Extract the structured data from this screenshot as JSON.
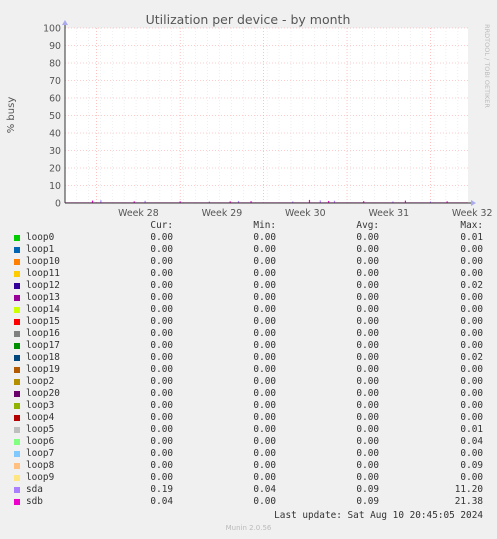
{
  "chart_data": {
    "type": "line",
    "title": "Utilization per device - by month",
    "ylabel": "% busy",
    "side_label": "RRDTOOL / TOBI OETIKER",
    "ylim": [
      0,
      100
    ],
    "yticks": [
      0,
      10,
      20,
      30,
      40,
      50,
      60,
      70,
      80,
      90,
      100
    ],
    "xticks": [
      "Week 28",
      "Week 29",
      "Week 30",
      "Week 31",
      "Week 32"
    ],
    "grid": true,
    "series": [
      {
        "name": "loop0",
        "color": "#00cc00"
      },
      {
        "name": "loop1",
        "color": "#0066b3"
      },
      {
        "name": "loop10",
        "color": "#ff8000"
      },
      {
        "name": "loop11",
        "color": "#ffcc00"
      },
      {
        "name": "loop12",
        "color": "#330099"
      },
      {
        "name": "loop13",
        "color": "#990099"
      },
      {
        "name": "loop14",
        "color": "#ccff00"
      },
      {
        "name": "loop15",
        "color": "#ff0000"
      },
      {
        "name": "loop16",
        "color": "#808080"
      },
      {
        "name": "loop17",
        "color": "#008f00"
      },
      {
        "name": "loop18",
        "color": "#00487d"
      },
      {
        "name": "loop19",
        "color": "#b35a00"
      },
      {
        "name": "loop2",
        "color": "#b38f00"
      },
      {
        "name": "loop20",
        "color": "#6b006b"
      },
      {
        "name": "loop3",
        "color": "#8fb300"
      },
      {
        "name": "loop4",
        "color": "#b30000"
      },
      {
        "name": "loop5",
        "color": "#bebebe"
      },
      {
        "name": "loop6",
        "color": "#80ff80"
      },
      {
        "name": "loop7",
        "color": "#80c9ff"
      },
      {
        "name": "loop8",
        "color": "#ffc080"
      },
      {
        "name": "loop9",
        "color": "#ffe680"
      },
      {
        "name": "sda",
        "color": "#aa80ff"
      },
      {
        "name": "sdb",
        "color": "#ee00cc"
      }
    ],
    "spikes": [
      {
        "week": 28.05,
        "value": 0.8
      },
      {
        "week": 28.15,
        "value": 1.0
      },
      {
        "week": 28.55,
        "value": 0.4
      },
      {
        "week": 28.68,
        "value": 0.7
      },
      {
        "week": 29.1,
        "value": 0.4
      },
      {
        "week": 29.45,
        "value": 0.3
      },
      {
        "week": 29.7,
        "value": 0.4
      },
      {
        "week": 29.8,
        "value": 0.6
      },
      {
        "week": 29.95,
        "value": 0.5
      },
      {
        "week": 30.45,
        "value": 0.3
      },
      {
        "week": 30.65,
        "value": 1.2
      },
      {
        "week": 30.78,
        "value": 0.9
      },
      {
        "week": 30.88,
        "value": 0.6
      },
      {
        "week": 30.95,
        "value": 0.7
      },
      {
        "week": 31.3,
        "value": 0.5
      },
      {
        "week": 31.65,
        "value": 0.3
      },
      {
        "week": 31.8,
        "value": 0.8
      },
      {
        "week": 32.1,
        "value": 0.3
      },
      {
        "week": 32.3,
        "value": 0.4
      }
    ]
  },
  "legend": {
    "headers": {
      "cur": "Cur:",
      "min": "Min:",
      "avg": "Avg:",
      "max": "Max:"
    },
    "rows": [
      {
        "name": "loop0",
        "color": "#00cc00",
        "cur": "0.00",
        "min": "0.00",
        "avg": "0.00",
        "max": "0.01"
      },
      {
        "name": "loop1",
        "color": "#0066b3",
        "cur": "0.00",
        "min": "0.00",
        "avg": "0.00",
        "max": "0.00"
      },
      {
        "name": "loop10",
        "color": "#ff8000",
        "cur": "0.00",
        "min": "0.00",
        "avg": "0.00",
        "max": "0.00"
      },
      {
        "name": "loop11",
        "color": "#ffcc00",
        "cur": "0.00",
        "min": "0.00",
        "avg": "0.00",
        "max": "0.00"
      },
      {
        "name": "loop12",
        "color": "#330099",
        "cur": "0.00",
        "min": "0.00",
        "avg": "0.00",
        "max": "0.02"
      },
      {
        "name": "loop13",
        "color": "#990099",
        "cur": "0.00",
        "min": "0.00",
        "avg": "0.00",
        "max": "0.00"
      },
      {
        "name": "loop14",
        "color": "#ccff00",
        "cur": "0.00",
        "min": "0.00",
        "avg": "0.00",
        "max": "0.00"
      },
      {
        "name": "loop15",
        "color": "#ff0000",
        "cur": "0.00",
        "min": "0.00",
        "avg": "0.00",
        "max": "0.00"
      },
      {
        "name": "loop16",
        "color": "#808080",
        "cur": "0.00",
        "min": "0.00",
        "avg": "0.00",
        "max": "0.00"
      },
      {
        "name": "loop17",
        "color": "#008f00",
        "cur": "0.00",
        "min": "0.00",
        "avg": "0.00",
        "max": "0.00"
      },
      {
        "name": "loop18",
        "color": "#00487d",
        "cur": "0.00",
        "min": "0.00",
        "avg": "0.00",
        "max": "0.02"
      },
      {
        "name": "loop19",
        "color": "#b35a00",
        "cur": "0.00",
        "min": "0.00",
        "avg": "0.00",
        "max": "0.00"
      },
      {
        "name": "loop2",
        "color": "#b38f00",
        "cur": "0.00",
        "min": "0.00",
        "avg": "0.00",
        "max": "0.00"
      },
      {
        "name": "loop20",
        "color": "#6b006b",
        "cur": "0.00",
        "min": "0.00",
        "avg": "0.00",
        "max": "0.00"
      },
      {
        "name": "loop3",
        "color": "#8fb300",
        "cur": "0.00",
        "min": "0.00",
        "avg": "0.00",
        "max": "0.00"
      },
      {
        "name": "loop4",
        "color": "#b30000",
        "cur": "0.00",
        "min": "0.00",
        "avg": "0.00",
        "max": "0.00"
      },
      {
        "name": "loop5",
        "color": "#bebebe",
        "cur": "0.00",
        "min": "0.00",
        "avg": "0.00",
        "max": "0.01"
      },
      {
        "name": "loop6",
        "color": "#80ff80",
        "cur": "0.00",
        "min": "0.00",
        "avg": "0.00",
        "max": "0.04"
      },
      {
        "name": "loop7",
        "color": "#80c9ff",
        "cur": "0.00",
        "min": "0.00",
        "avg": "0.00",
        "max": "0.00"
      },
      {
        "name": "loop8",
        "color": "#ffc080",
        "cur": "0.00",
        "min": "0.00",
        "avg": "0.00",
        "max": "0.09"
      },
      {
        "name": "loop9",
        "color": "#ffe680",
        "cur": "0.00",
        "min": "0.00",
        "avg": "0.00",
        "max": "0.00"
      },
      {
        "name": "sda",
        "color": "#aa80ff",
        "cur": "0.19",
        "min": "0.04",
        "avg": "0.09",
        "max": "11.20"
      },
      {
        "name": "sdb",
        "color": "#ee00cc",
        "cur": "0.04",
        "min": "0.00",
        "avg": "0.09",
        "max": "21.38"
      }
    ]
  },
  "footer": {
    "last_update": "Last update: Sat Aug 10 20:45:05 2024",
    "version": "Munin 2.0.56"
  }
}
